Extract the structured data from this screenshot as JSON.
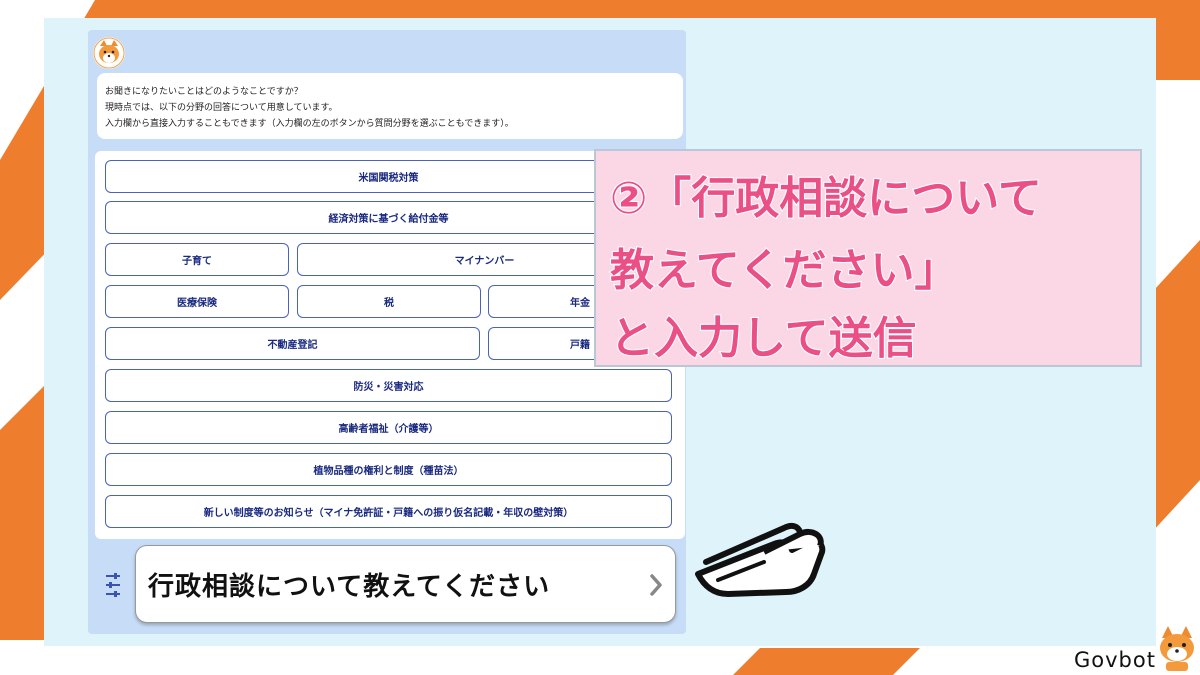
{
  "intro": {
    "line1": "お聞きになりたいことはどのようなことですか？",
    "line2": "現時点では、以下の分野の回答について用意しています。",
    "line3": "入力欄から直接入力することもできます（入力欄の左のボタンから質問分野を選ぶこともできます）。"
  },
  "topics": {
    "t1": "米国関税対策",
    "t2": "経済対策に基づく給付金等",
    "t3": "子育て",
    "t4": "マイナンバー",
    "t5": "医療保険",
    "t6": "税",
    "t7": "年金",
    "t8": "不動産登記",
    "t9": "戸籍",
    "t10": "防災・災害対応",
    "t11": "高齢者福祉（介護等）",
    "t12": "植物品種の権利と制度（種苗法）",
    "t13": "新しい制度等のお知らせ（マイナ免許証・戸籍への振り仮名記載・年収の壁対策）"
  },
  "input": {
    "value": "行政相談について教えてください"
  },
  "callout": {
    "line1": "②「行政相談について",
    "line2": "教えてください」",
    "line3": "と入力して送信"
  },
  "brand": {
    "name": "Govbot"
  },
  "colors": {
    "accent_orange": "#ee7d2e",
    "callout_text": "#ea4f86",
    "button_border": "#4a63b8"
  },
  "icons": {
    "avatar": "bot-avatar-icon",
    "menu": "topic-menu-icon",
    "send": "send-chevron-icon",
    "pointer": "pointing-hand-icon",
    "logo": "govbot-logo-icon"
  }
}
